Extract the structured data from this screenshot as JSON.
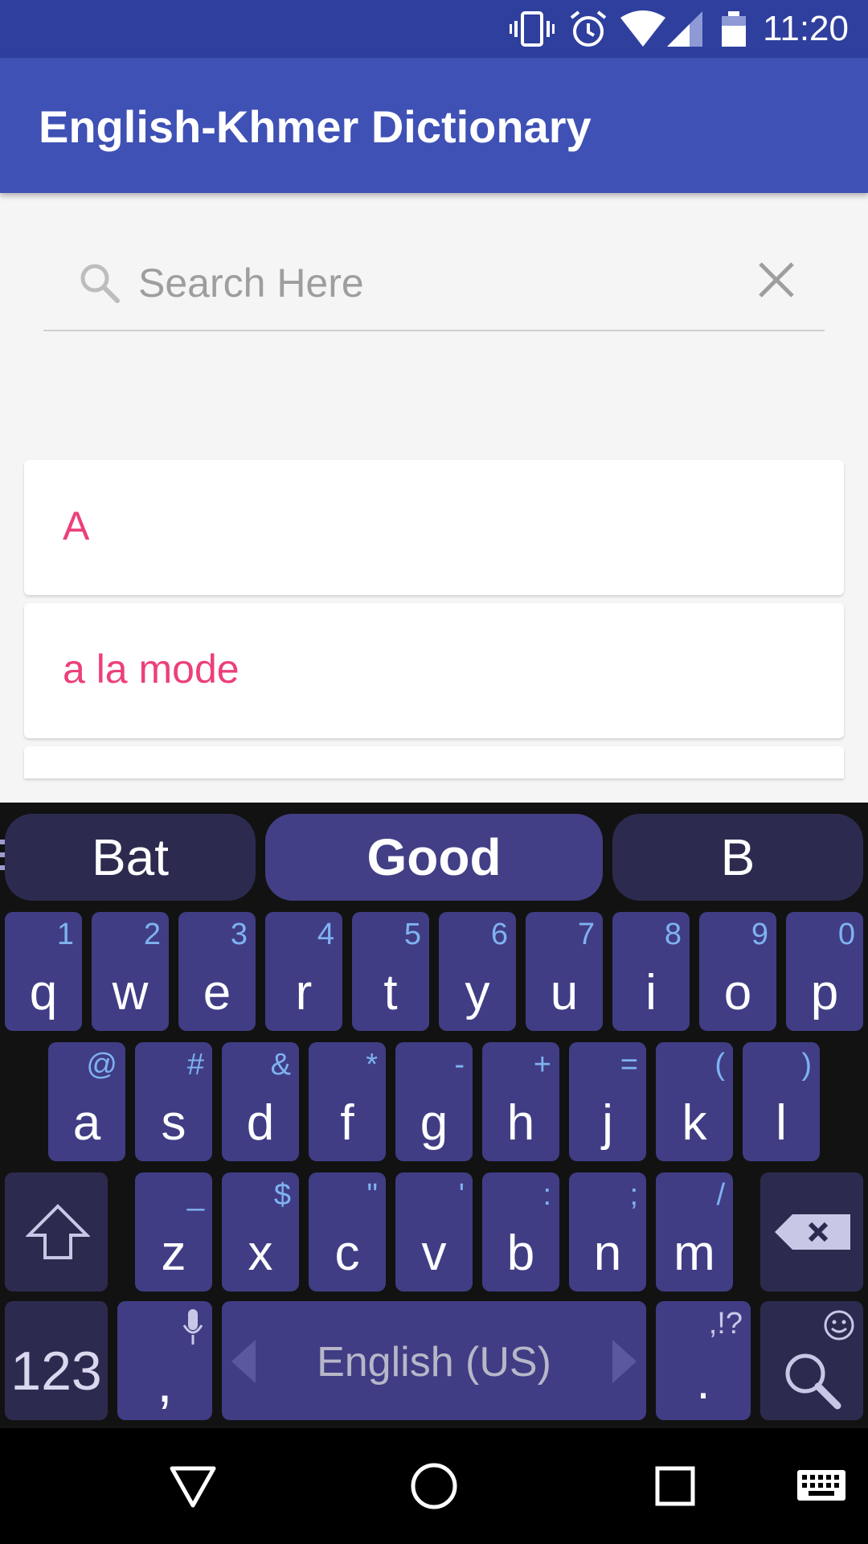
{
  "status_bar": {
    "time": "11:20",
    "icons": [
      "vibrate-icon",
      "alarm-icon",
      "wifi-icon",
      "cell-signal-icon",
      "battery-icon"
    ]
  },
  "app_bar": {
    "title": "English-Khmer Dictionary"
  },
  "search": {
    "placeholder": "Search Here",
    "value": ""
  },
  "words": [
    "A",
    "a la mode"
  ],
  "keyboard": {
    "suggestions": [
      "Bat",
      "Good",
      "B"
    ],
    "row1": [
      {
        "key": "q",
        "alt": "1"
      },
      {
        "key": "w",
        "alt": "2"
      },
      {
        "key": "e",
        "alt": "3"
      },
      {
        "key": "r",
        "alt": "4"
      },
      {
        "key": "t",
        "alt": "5"
      },
      {
        "key": "y",
        "alt": "6"
      },
      {
        "key": "u",
        "alt": "7"
      },
      {
        "key": "i",
        "alt": "8"
      },
      {
        "key": "o",
        "alt": "9"
      },
      {
        "key": "p",
        "alt": "0"
      }
    ],
    "row2": [
      {
        "key": "a",
        "alt": "@"
      },
      {
        "key": "s",
        "alt": "#"
      },
      {
        "key": "d",
        "alt": "&"
      },
      {
        "key": "f",
        "alt": "*"
      },
      {
        "key": "g",
        "alt": "-"
      },
      {
        "key": "h",
        "alt": "+"
      },
      {
        "key": "j",
        "alt": "="
      },
      {
        "key": "k",
        "alt": "("
      },
      {
        "key": "l",
        "alt": ")"
      }
    ],
    "row3": [
      {
        "key": "z",
        "alt": "_"
      },
      {
        "key": "x",
        "alt": "$"
      },
      {
        "key": "c",
        "alt": "\""
      },
      {
        "key": "v",
        "alt": "'"
      },
      {
        "key": "b",
        "alt": ":"
      },
      {
        "key": "n",
        "alt": ";"
      },
      {
        "key": "m",
        "alt": "/"
      }
    ],
    "numbers_label": "123",
    "comma_label": ",",
    "space_label": "English (US)",
    "period_label": ".",
    "period_alt": ",!?",
    "accent_color": "#403d85"
  },
  "nav_bar": {
    "icons": [
      "back-icon",
      "home-icon",
      "recents-icon",
      "keyboard-switch-icon"
    ]
  }
}
